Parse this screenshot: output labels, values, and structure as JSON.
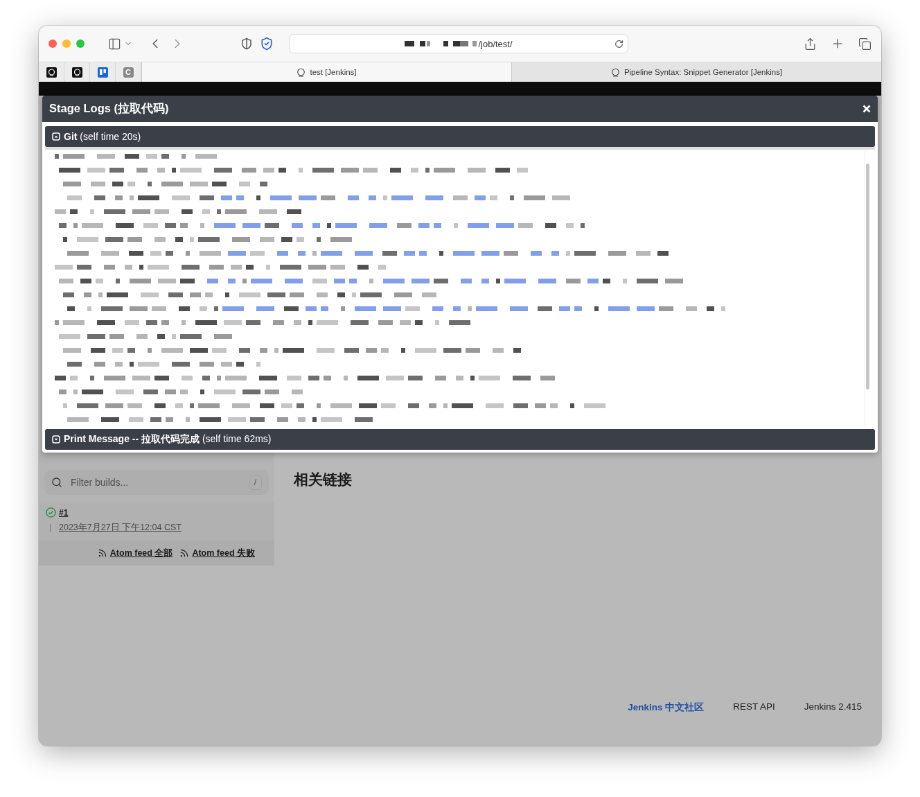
{
  "browser": {
    "url": "/job/test/",
    "pinned_tabs": [
      {
        "kind": "jenkins"
      },
      {
        "kind": "jenkins"
      },
      {
        "kind": "board"
      },
      {
        "kind": "letter",
        "label": "C"
      }
    ],
    "tabs": [
      {
        "label": "test [Jenkins]",
        "selected": true
      },
      {
        "label": "Pipeline Syntax: Snippet Generator [Jenkins]",
        "selected": false
      }
    ]
  },
  "modal": {
    "title": "Stage Logs (拉取代码)",
    "sections": [
      {
        "name": "Git",
        "detail": "(self time 20s)",
        "expanded": true
      },
      {
        "name": "Print Message -- 拉取代码完成",
        "detail": "(self time 62ms)",
        "expanded": false
      }
    ]
  },
  "sidebar": {
    "filter": {
      "placeholder": "Filter builds...",
      "shortcut": "/"
    },
    "builds": [
      {
        "number": "#1",
        "passed": true,
        "time": "2023年7月27日 下午12:04 CST"
      }
    ],
    "feeds": [
      "Atom feed 全部",
      "Atom feed 失败"
    ]
  },
  "main": {
    "heading": "相关链接"
  },
  "footer": [
    {
      "label": "Jenkins 中文社区",
      "kind": "link"
    },
    {
      "label": "REST API",
      "kind": "plain"
    },
    {
      "label": "Jenkins 2.415",
      "kind": "plain"
    }
  ]
}
